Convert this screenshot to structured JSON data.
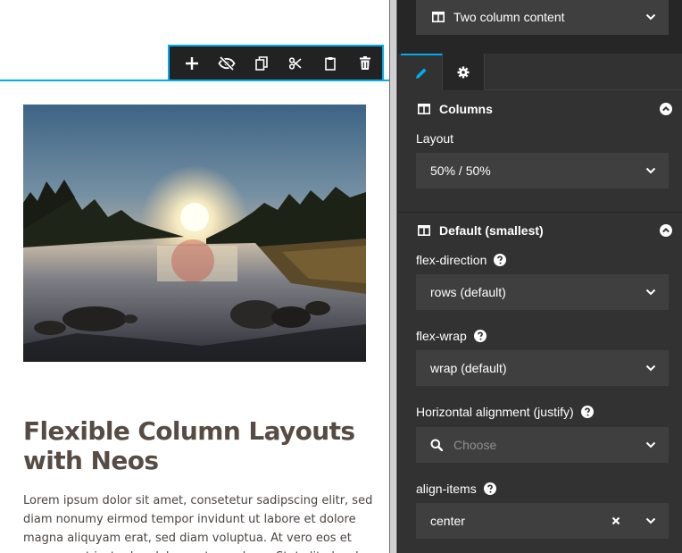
{
  "toolbar": {
    "buttons": [
      {
        "name": "add-button",
        "icon": "plus-icon"
      },
      {
        "name": "hide-button",
        "icon": "eye-slash-icon"
      },
      {
        "name": "copy-button",
        "icon": "copy-icon"
      },
      {
        "name": "cut-button",
        "icon": "scissors-icon"
      },
      {
        "name": "paste-button",
        "icon": "clipboard-icon"
      },
      {
        "name": "delete-button",
        "icon": "trash-icon"
      }
    ]
  },
  "content": {
    "image_alt_icon": "sunset-river-photo",
    "headline": "Flexible Column Layouts with Neos",
    "body": "Lorem ipsum dolor sit amet, consetetur sadipscing elitr, sed diam nonumy eirmod tempor invidunt ut labore et dolore magna aliquyam erat, sed diam voluptua. At vero eos et accusam et justo duo dolores et ea rebum. Stet clita kasd"
  },
  "inspector": {
    "node_type": "Two column content",
    "tabs": [
      {
        "icon": "pencil-icon",
        "active": true
      },
      {
        "icon": "gear-icon",
        "active": false
      }
    ],
    "groups": {
      "columns": {
        "title": "Columns",
        "layout_label": "Layout",
        "layout_value": "50% / 50%"
      },
      "default": {
        "title": "Default (smallest)",
        "flex_direction_label": "flex-direction",
        "flex_direction_value": "rows (default)",
        "flex_wrap_label": "flex-wrap",
        "flex_wrap_value": "wrap (default)",
        "justify_label": "Horizontal alignment (justify)",
        "justify_placeholder": "Choose",
        "align_items_label": "align-items",
        "align_items_value": "center"
      }
    }
  },
  "colors": {
    "accent": "#00adee",
    "inspector_bg": "#323232",
    "field_bg": "#3f3f3f",
    "headline": "#564c45"
  }
}
